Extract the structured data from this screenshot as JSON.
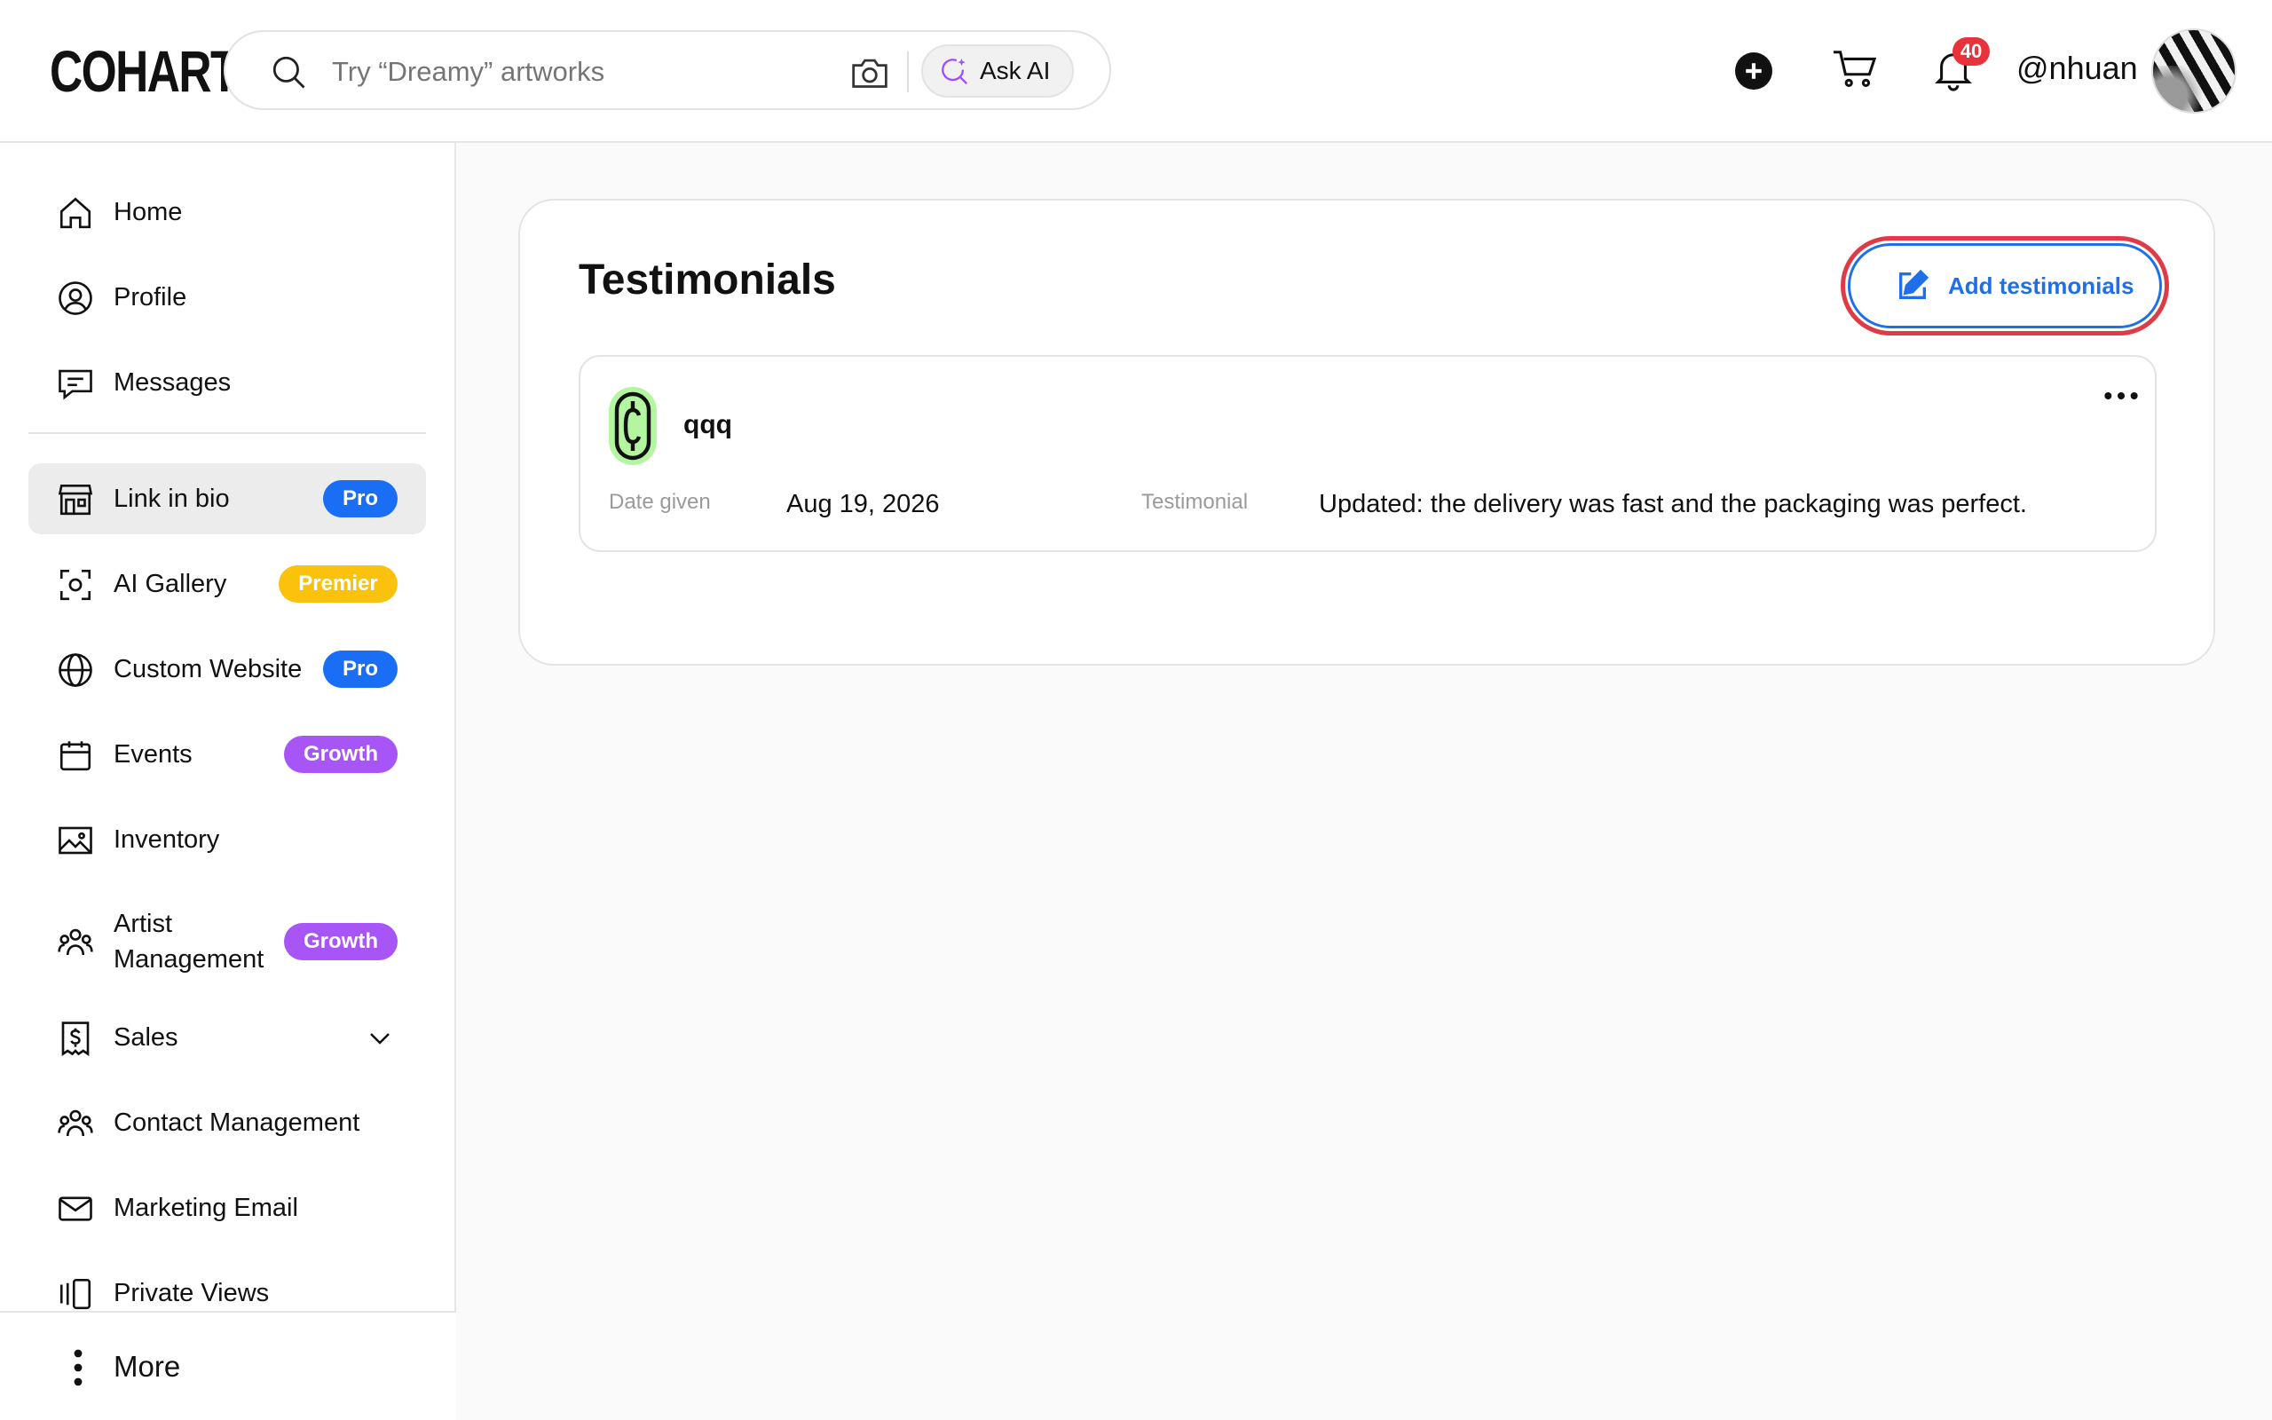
{
  "header": {
    "logo": "COHART",
    "search_placeholder": "Try “Dreamy” artworks",
    "ask_ai_label": "Ask AI",
    "notification_count": "40",
    "username": "@nhuan"
  },
  "sidebar": {
    "items": [
      {
        "label": "Home"
      },
      {
        "label": "Profile"
      },
      {
        "label": "Messages"
      },
      {
        "label": "Link in bio",
        "badge": "Pro"
      },
      {
        "label": "AI Gallery",
        "badge": "Premier"
      },
      {
        "label": "Custom Website",
        "badge": "Pro"
      },
      {
        "label": "Events",
        "badge": "Growth"
      },
      {
        "label": "Inventory"
      },
      {
        "label": "Artist Management",
        "badge": "Growth"
      },
      {
        "label": "Sales"
      },
      {
        "label": "Contact Management"
      },
      {
        "label": "Marketing Email"
      },
      {
        "label": "Private Views"
      }
    ],
    "more_label": "More"
  },
  "main": {
    "title": "Testimonials",
    "add_button_label": "Add testimonials",
    "testimonials": [
      {
        "name": "qqq",
        "date_label": "Date given",
        "date": "Aug 19, 2026",
        "testimonial_label": "Testimonial",
        "text": "Updated: the delivery was fast and the packaging was perfect."
      }
    ]
  },
  "colors": {
    "pro_badge": "#1a6ef5",
    "premier_badge": "#fbc20d",
    "growth_badge": "#a855f7",
    "primary_button": "#1f6fe8",
    "highlight_ring": "#e03a47",
    "notification_badge": "#e8333a",
    "avatar_logo_bg": "#b4f5a0"
  }
}
